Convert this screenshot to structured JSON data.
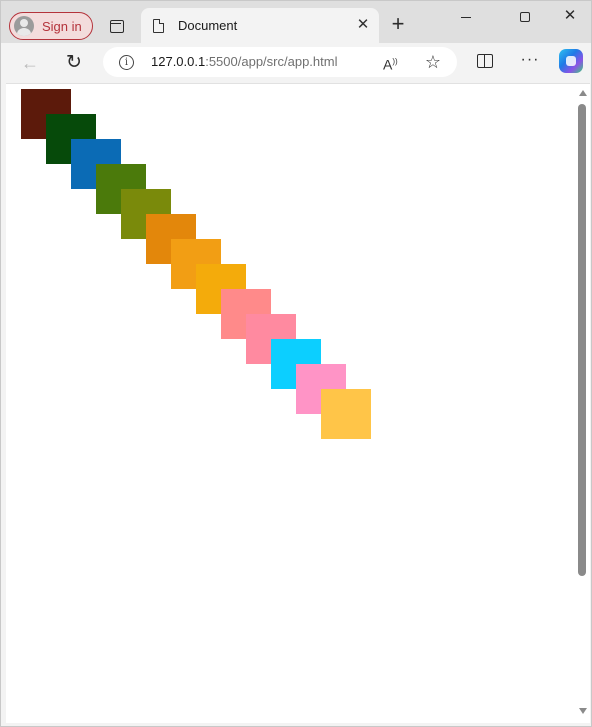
{
  "browser": {
    "signin_label": "Sign in",
    "tab_title": "Document",
    "tab_close_glyph": "✕",
    "new_tab_glyph": "+",
    "close_glyph": "✕",
    "url_host": "127.0.0.1",
    "url_path": ":5500/app/src/app.html",
    "info_glyph": "i",
    "back_glyph": "←",
    "reload_glyph": "↻",
    "star_glyph": "☆",
    "read_aloud_glyph": "A",
    "more_glyph": "···",
    "icons": [
      "profile-avatar-icon",
      "tab-actions-icon",
      "document-icon",
      "close-icon",
      "plus-icon",
      "minimize-icon",
      "maximize-icon",
      "back-arrow-icon",
      "reload-icon",
      "info-icon",
      "read-aloud-icon",
      "favorite-star-icon",
      "split-screen-icon",
      "more-icon",
      "copilot-icon"
    ]
  },
  "page": {
    "boxes": [
      {
        "color": "#5c1a0b"
      },
      {
        "color": "#064a0a"
      },
      {
        "color": "#0b6bb5"
      },
      {
        "color": "#4b7a0b"
      },
      {
        "color": "#7a8a0b"
      },
      {
        "color": "#e3870b"
      },
      {
        "color": "#f29e14"
      },
      {
        "color": "#f4ab0b"
      },
      {
        "color": "#ff8a8a"
      },
      {
        "color": "#ff8aa0"
      },
      {
        "color": "#0ccfff"
      },
      {
        "color": "#ff94c6"
      },
      {
        "color": "#ffc548"
      }
    ]
  }
}
